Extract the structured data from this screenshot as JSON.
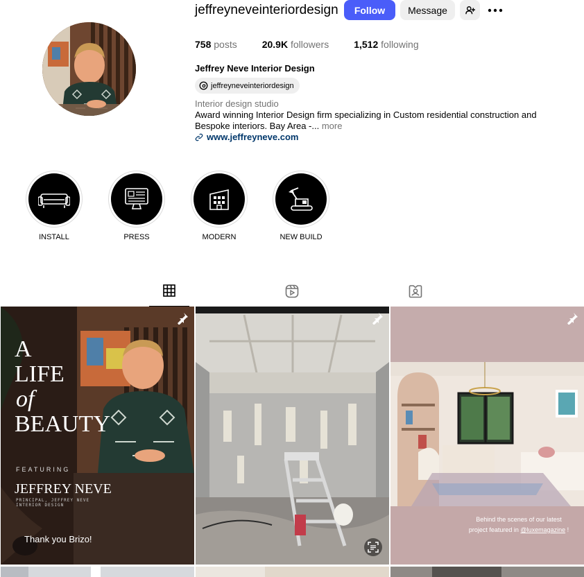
{
  "profile": {
    "username": "jeffreyneveinteriordesign",
    "follow_label": "Follow",
    "message_label": "Message",
    "stats": {
      "posts_count": "758",
      "posts_label": "posts",
      "followers_count": "20.9K",
      "followers_label": "followers",
      "following_count": "1,512",
      "following_label": "following"
    },
    "full_name": "Jeffrey Neve Interior Design",
    "threads_handle": "jeffreyneveinteriordesign",
    "category": "Interior design studio",
    "bio": "Award winning Interior Design firm specializing in Custom residential construction and Bespoke interiors. Bay Area -...",
    "bio_more": "more",
    "website": "www.jeffreyneve.com"
  },
  "highlights": [
    {
      "label": "INSTALL",
      "icon": "sofa-icon"
    },
    {
      "label": "PRESS",
      "icon": "monitor-news-icon"
    },
    {
      "label": "MODERN",
      "icon": "building-icon"
    },
    {
      "label": "NEW BUILD",
      "icon": "excavator-icon"
    }
  ],
  "tabs": [
    {
      "name": "posts",
      "icon": "grid-icon",
      "active": true
    },
    {
      "name": "reels",
      "icon": "reels-icon",
      "active": false
    },
    {
      "name": "tagged",
      "icon": "tagged-icon",
      "active": false
    }
  ],
  "posts": [
    {
      "pinned": true,
      "headline_1": "A",
      "headline_2": "LIFE",
      "headline_3": "of",
      "headline_4": "BEAUTY",
      "featuring": "FEATURING",
      "name": "JEFFREY NEVE",
      "subtitle_1": "PRINCIPAL, JEFFREY NEVE",
      "subtitle_2": "INTERIOR DESIGN",
      "thanks": "Thank you Brizo!"
    },
    {
      "pinned": true
    },
    {
      "pinned": true,
      "caption_line1": "Behind the scenes of our latest",
      "caption_line2_prefix": "project featured in ",
      "caption_mention": "@luxemagazine",
      "caption_line2_suffix": " !"
    }
  ],
  "colors": {
    "follow_button": "#4a5df9",
    "link": "#00376b",
    "secondary_text": "#737373"
  }
}
